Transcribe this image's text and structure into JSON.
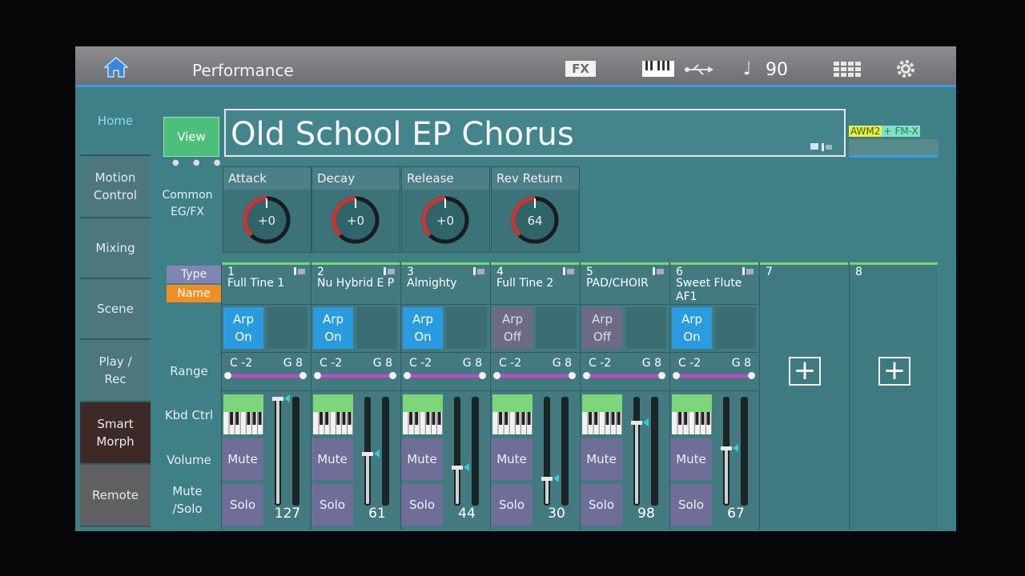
{
  "header": {
    "title": "Performance",
    "fx_label": "FX",
    "tempo": "90",
    "note_symbol": "♩"
  },
  "sidebar": {
    "items": [
      {
        "label": "Home"
      },
      {
        "label": "Motion Control"
      },
      {
        "label": "Mixing"
      },
      {
        "label": "Scene"
      },
      {
        "label": "Play / Rec"
      },
      {
        "label": "Smart Morph"
      },
      {
        "label": "Remote"
      }
    ]
  },
  "view_button": "View",
  "page_dots": "● ● ●",
  "performance_name": "Old School EP Chorus",
  "badge": {
    "awm": "AWM2",
    "plus": "+",
    "fmx": "FM-X"
  },
  "common": {
    "label": "Common EG/FX",
    "knobs": [
      {
        "label": "Attack",
        "value": "+0",
        "level": 0.5
      },
      {
        "label": "Decay",
        "value": "+0",
        "level": 0.5
      },
      {
        "label": "Release",
        "value": "+0",
        "level": 0.5
      },
      {
        "label": "Rev Return",
        "value": "64",
        "level": 0.5
      }
    ]
  },
  "rows": {
    "type": "Type",
    "name": "Name",
    "range": "Range",
    "kbd_ctrl": "Kbd Ctrl",
    "volume": "Volume",
    "mute_solo": "Mute /Solo"
  },
  "parts": [
    {
      "num": "1",
      "name": "Full Tine 1",
      "arp": "Arp On",
      "arp_on": true,
      "range_lo": "C -2",
      "range_hi": "G 8",
      "mute": "Mute",
      "solo": "Solo",
      "volume": "127",
      "level": 1.0
    },
    {
      "num": "2",
      "name": "Nu Hybrid E P",
      "arp": "Arp On",
      "arp_on": true,
      "range_lo": "C -2",
      "range_hi": "G 8",
      "mute": "Mute",
      "solo": "Solo",
      "volume": "61",
      "level": 0.48
    },
    {
      "num": "3",
      "name": "Almighty",
      "arp": "Arp On",
      "arp_on": true,
      "range_lo": "C -2",
      "range_hi": "G 8",
      "mute": "Mute",
      "solo": "Solo",
      "volume": "44",
      "level": 0.35
    },
    {
      "num": "4",
      "name": "Full Tine 2",
      "arp": "Arp Off",
      "arp_on": false,
      "range_lo": "C -2",
      "range_hi": "G 8",
      "mute": "Mute",
      "solo": "Solo",
      "volume": "30",
      "level": 0.24
    },
    {
      "num": "5",
      "name": "PAD/CHOIR",
      "arp": "Arp Off",
      "arp_on": false,
      "range_lo": "C -2",
      "range_hi": "G 8",
      "mute": "Mute",
      "solo": "Solo",
      "volume": "98",
      "level": 0.77
    },
    {
      "num": "6",
      "name": "Sweet Flute AF1",
      "arp": "Arp On",
      "arp_on": true,
      "range_lo": "C -2",
      "range_hi": "G 8",
      "mute": "Mute",
      "solo": "Solo",
      "volume": "67",
      "level": 0.53
    }
  ],
  "empty_parts": [
    {
      "num": "7",
      "add": "+"
    },
    {
      "num": "8",
      "add": "+"
    }
  ],
  "colors": {
    "accent_blue": "#2a9be0",
    "range_magenta": "#d042c8",
    "knob_red": "#d63030",
    "view_green": "#4cc07a",
    "name_orange": "#f08e24"
  }
}
